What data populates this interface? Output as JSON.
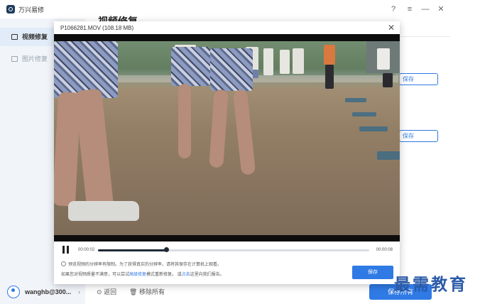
{
  "app": {
    "title": "万兴易修"
  },
  "window_controls": {
    "help": "?",
    "menu": "≡",
    "minimize": "—",
    "close": "✕"
  },
  "sidebar": {
    "items": [
      {
        "label": "视频修复",
        "icon": "video-icon",
        "active": true
      },
      {
        "label": "图片修复",
        "icon": "image-icon",
        "active": false
      }
    ],
    "user": {
      "name": "wanghb@300...",
      "chevron": "›"
    }
  },
  "main": {
    "heading": "视频修复",
    "row_save_labels": [
      "保存",
      "保存"
    ],
    "back_label": "返回",
    "remove_all_label": "移除所有",
    "save_all_label": "保存所有"
  },
  "modal": {
    "title": "P1066281.MOV  (108.18  MB)",
    "close": "✕",
    "player": {
      "state": "paused",
      "current_time": "00:00:02",
      "total_time": "00:00:08",
      "progress": 0.25
    },
    "info_text": "预览视频的分辨率有限制。为了获得真实的分辨率，请将其保存在计算机上观看。",
    "hint": {
      "before": "如果您对视频质量不满意，可以尝试",
      "link1": "高级修复",
      "middle": "模式重新修复。 或",
      "link2": "点击",
      "after": "这里向我们报告。"
    },
    "save_label": "保存"
  },
  "watermark": "最需教育",
  "colors": {
    "accent": "#2f7ae5",
    "sidebar_bg": "#f1f5fa"
  }
}
